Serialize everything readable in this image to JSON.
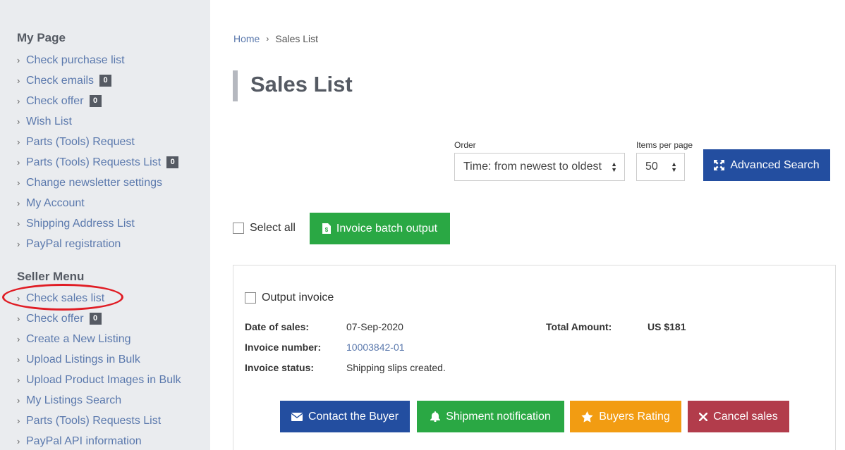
{
  "sidebar": {
    "my_page": {
      "heading": "My Page",
      "items": [
        {
          "label": "Check purchase list"
        },
        {
          "label": "Check emails",
          "badge": "0"
        },
        {
          "label": "Check offer",
          "badge": "0"
        },
        {
          "label": "Wish List"
        },
        {
          "label": "Parts (Tools) Request"
        },
        {
          "label": "Parts (Tools) Requests List",
          "badge": "0"
        },
        {
          "label": "Change newsletter settings"
        },
        {
          "label": "My Account"
        },
        {
          "label": "Shipping Address List"
        },
        {
          "label": "PayPal registration"
        }
      ]
    },
    "seller_menu": {
      "heading": "Seller Menu",
      "items": [
        {
          "label": "Check sales list"
        },
        {
          "label": "Check offer",
          "badge": "0"
        },
        {
          "label": "Create a New Listing"
        },
        {
          "label": "Upload Listings in Bulk"
        },
        {
          "label": "Upload Product Images in Bulk"
        },
        {
          "label": "My Listings Search"
        },
        {
          "label": "Parts (Tools) Requests List"
        },
        {
          "label": "PayPal API information"
        }
      ]
    }
  },
  "breadcrumb": {
    "home": "Home",
    "current": "Sales List"
  },
  "page_title": "Sales List",
  "controls": {
    "order_label": "Order",
    "order_value": "Time: from newest to oldest",
    "per_page_label": "Items per page",
    "per_page_value": "50",
    "advanced_search": "Advanced Search"
  },
  "batch": {
    "select_all": "Select all",
    "invoice_batch_output": "Invoice batch output"
  },
  "sale": {
    "output_invoice": "Output invoice",
    "date_key": "Date of sales:",
    "date_value": "07-Sep-2020",
    "total_key": "Total Amount:",
    "total_value": "US $181",
    "invoice_number_key": "Invoice number:",
    "invoice_number_value": "10003842-01",
    "invoice_status_key": "Invoice status:",
    "invoice_status_value": "Shipping slips created."
  },
  "actions": {
    "contact_buyer": "Contact the Buyer",
    "shipment_notification": "Shipment notification",
    "buyers_rating": "Buyers Rating",
    "cancel_sales": "Cancel sales"
  },
  "colors": {
    "accent_blue": "#234ea0",
    "green": "#2aa844",
    "orange": "#f29c12",
    "red": "#b23c4b",
    "annotation": "#e01c24"
  }
}
